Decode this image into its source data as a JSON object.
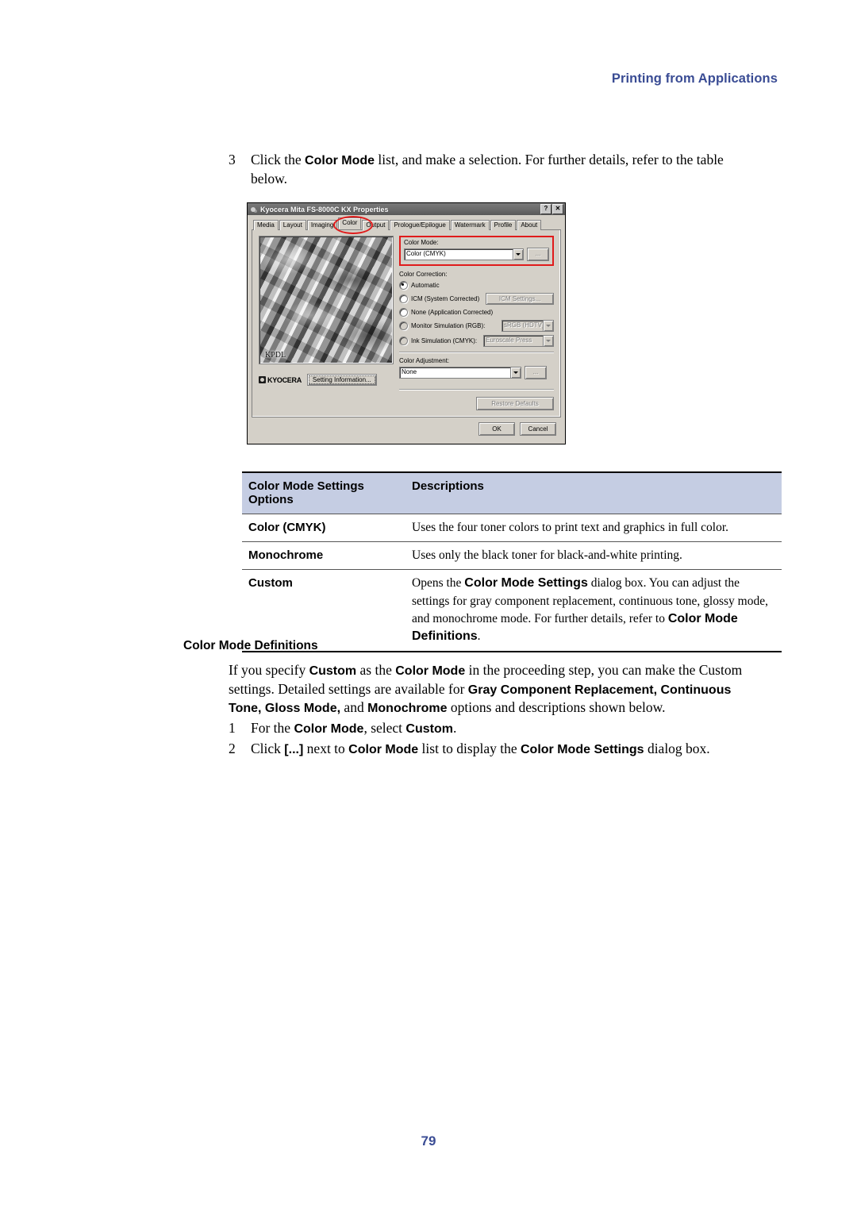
{
  "header": {
    "running_head": "Printing from Applications"
  },
  "step3": {
    "number": "3",
    "text_before": "Click the ",
    "bold1": "Color Mode",
    "text_after": " list, and make a selection. For further details, refer to the table below."
  },
  "dialog": {
    "title": "Kyocera Mita FS-8000C KX Properties",
    "title_icon": "printer-icon",
    "help_button": "?",
    "close_button": "✕",
    "tabs": [
      {
        "label": "Media",
        "active": false
      },
      {
        "label": "Layout",
        "active": false
      },
      {
        "label": "Imaging",
        "active": false
      },
      {
        "label": "Color",
        "active": true
      },
      {
        "label": "Output",
        "active": false
      },
      {
        "label": "Prologue/Epilogue",
        "active": false
      },
      {
        "label": "Watermark",
        "active": false
      },
      {
        "label": "Profile",
        "active": false
      },
      {
        "label": "About",
        "active": false
      }
    ],
    "preview": {
      "watermark": "KPDL"
    },
    "brand": "KYOCERA",
    "setting_information_button": "Setting Information...",
    "color_mode": {
      "label": "Color Mode:",
      "value": "Color (CMYK)",
      "ellipsis_button": "...",
      "highlight_color": "#e01b1b"
    },
    "color_correction": {
      "label": "Color Correction:",
      "options": [
        {
          "label": "Automatic",
          "checked": true,
          "disabled": false
        },
        {
          "label": "ICM (System Corrected)",
          "checked": false,
          "disabled": false
        },
        {
          "label": "None (Application Corrected)",
          "checked": false,
          "disabled": false
        },
        {
          "label": "Monitor Simulation (RGB):",
          "checked": false,
          "disabled": false
        },
        {
          "label": "Ink Simulation (CMYK):",
          "checked": false,
          "disabled": false
        }
      ],
      "icm_settings_button": "ICM Settings...",
      "monitor_simulation_value": "sRGB (HDTV)",
      "ink_simulation_value": "Euroscale Press"
    },
    "color_adjustment": {
      "label": "Color Adjustment:",
      "value": "None",
      "ellipsis_button": "..."
    },
    "restore_defaults_button": "Restore Defaults",
    "ok_button": "OK",
    "cancel_button": "Cancel"
  },
  "table": {
    "headers": [
      "Color Mode Settings Options",
      "Descriptions"
    ],
    "header_bg": "#c5cde3",
    "rows": [
      {
        "option": "Color (CMYK)",
        "description": "Uses the four toner colors to print text and graphics in full color."
      },
      {
        "option": "Monochrome",
        "description": "Uses only the black toner for black-and-white printing."
      },
      {
        "option": "Custom",
        "description_parts": [
          {
            "text": "Opens the ",
            "bold": false
          },
          {
            "text": "Color Mode Settings",
            "bold": true
          },
          {
            "text": " dialog box. You can adjust the settings for gray component replacement, continuous tone, glossy mode, and monochrome mode. For further details, refer to ",
            "bold": false
          },
          {
            "text": "Color Mode Definitions",
            "bold": true
          },
          {
            "text": ".",
            "bold": false
          }
        ]
      }
    ]
  },
  "definitions": {
    "title": "Color Mode Definitions",
    "paragraph_parts": [
      {
        "text": "If you specify ",
        "bold": false
      },
      {
        "text": "Custom",
        "bold": true
      },
      {
        "text": " as the ",
        "bold": false
      },
      {
        "text": "Color Mode",
        "bold": true
      },
      {
        "text": " in the proceeding step, you can make the Custom settings. Detailed settings are available for ",
        "bold": false
      },
      {
        "text": "Gray Component Replacement, Continuous Tone, Gloss Mode,",
        "bold": true
      },
      {
        "text": " and ",
        "bold": false
      },
      {
        "text": "Monochrome",
        "bold": true
      },
      {
        "text": " options and descriptions shown below.",
        "bold": false
      }
    ],
    "steps": [
      {
        "number": "1",
        "parts": [
          {
            "text": "For the ",
            "bold": false
          },
          {
            "text": "Color Mode",
            "bold": true
          },
          {
            "text": ", select ",
            "bold": false
          },
          {
            "text": "Custom",
            "bold": true
          },
          {
            "text": ".",
            "bold": false
          }
        ]
      },
      {
        "number": "2",
        "parts": [
          {
            "text": "Click ",
            "bold": false
          },
          {
            "text": "[...]",
            "bold": true
          },
          {
            "text": " next to ",
            "bold": false
          },
          {
            "text": "Color Mode",
            "bold": true
          },
          {
            "text": " list to display the ",
            "bold": false
          },
          {
            "text": "Color Mode Settings",
            "bold": true
          },
          {
            "text": " dialog box.",
            "bold": false
          }
        ]
      }
    ]
  },
  "footer": {
    "page_number": "79"
  }
}
